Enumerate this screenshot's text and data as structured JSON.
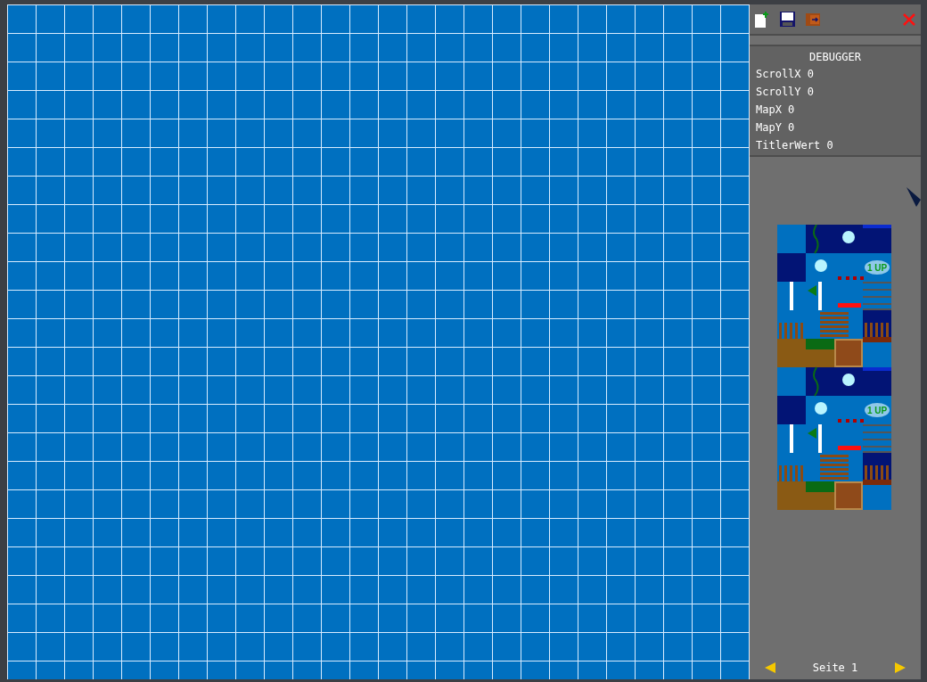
{
  "debugger": {
    "title": "DEBUGGER",
    "lines": [
      "ScrollX 0",
      "ScrollY 0",
      "MapX 0",
      "MapY 0",
      "TitlerWert 0"
    ]
  },
  "tileset": {
    "tile_labels": [
      "1 UP",
      "1 UP"
    ]
  },
  "pager": {
    "label": "Seite 1"
  }
}
